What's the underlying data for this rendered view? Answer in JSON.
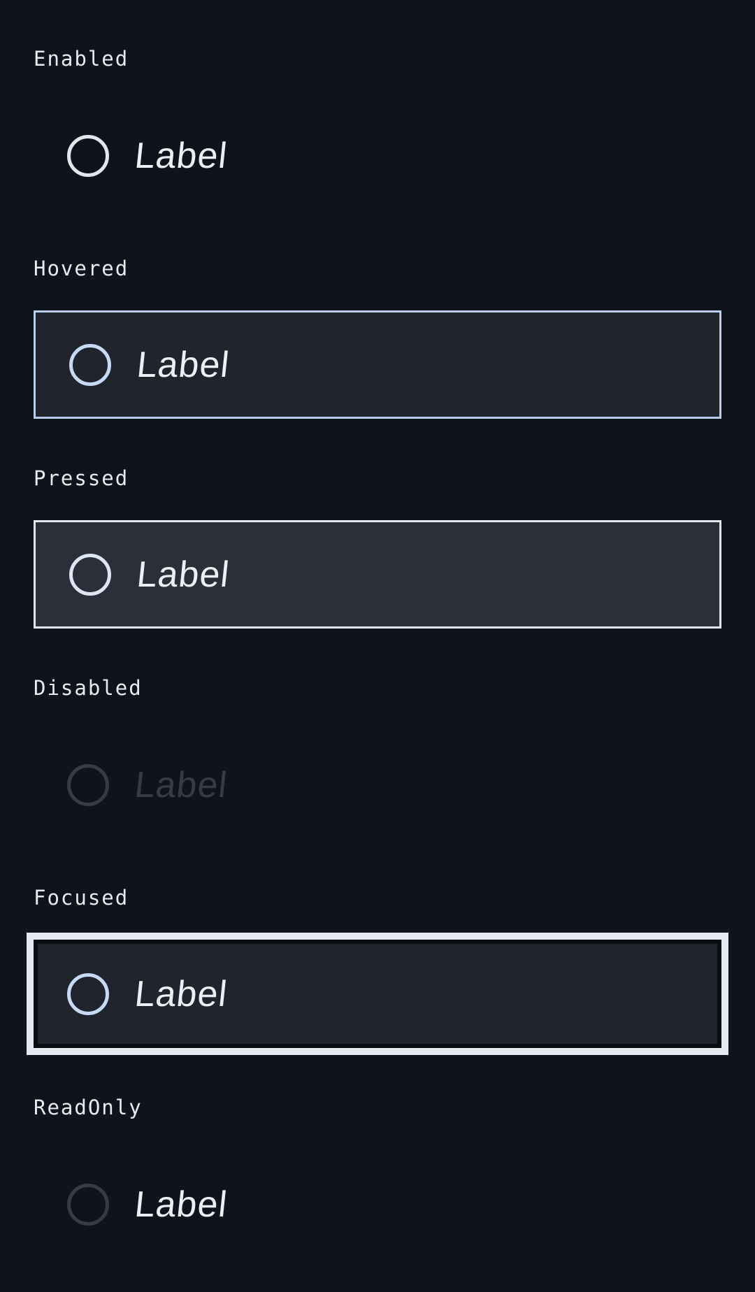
{
  "states": [
    {
      "title": "Enabled",
      "label": "Label"
    },
    {
      "title": "Hovered",
      "label": "Label"
    },
    {
      "title": "Pressed",
      "label": "Label"
    },
    {
      "title": "Disabled",
      "label": "Label"
    },
    {
      "title": "Focused",
      "label": "Label"
    },
    {
      "title": "ReadOnly",
      "label": "Label"
    }
  ],
  "colors": {
    "background": "#10131a",
    "hover_border": "#b8cde9",
    "focus_outline": "#e6e9f0",
    "disabled": "#363b46"
  }
}
